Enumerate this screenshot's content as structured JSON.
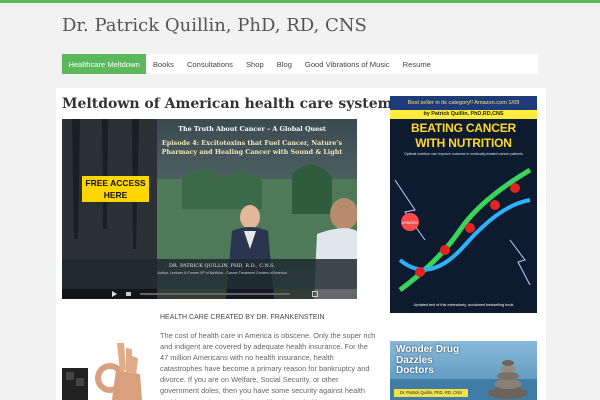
{
  "site": {
    "title": "Dr. Patrick Quillin, PhD, RD, CNS",
    "accent_color": "#5cb85c"
  },
  "nav": {
    "items": [
      {
        "label": "Healthcare Meltdown",
        "active": true
      },
      {
        "label": "Books"
      },
      {
        "label": "Consultations"
      },
      {
        "label": "Shop"
      },
      {
        "label": "Blog"
      },
      {
        "label": "Good Vibrations of Music"
      },
      {
        "label": "Resume"
      }
    ]
  },
  "post": {
    "title": "Meltdown of American health care system",
    "video": {
      "title": "The Truth About Cancer – A Global Quest",
      "subtitle": "Episode 4: Excitotoxins that Fuel Cancer, Nature’s Pharmacy and Healing Cancer with Sound & Light",
      "badge": "FREE ACCESS HERE",
      "caption": "DR. PATRICK QUILLIN, PHD, R.D., C.N.S.",
      "caption2": "Author, Lecturer & Former VP of Nutrition - Cancer Treatment Centers of America"
    },
    "byline": "HEALTH CARE CREATED BY DR. FRANKENSTEIN",
    "body": "The cost of health care in America is obscene. Only the super rich and indigent are covered by adequate health insurance. For the 47 million Americans with no health insurance, health catastrophes have become a primary reason for bankruptcy and divorce. If you are on Welfare, Social Security, or other government doles, then you have some security against health problems. Border states from California to Florida spend many billions annually treating illegal aliens and"
  },
  "sidebar": {
    "book1": {
      "banner": "Best seller in its category!! Amazon.com 1/09",
      "author": "by Patrick Quillin, PhD,RD,CNS",
      "title_line1": "BEATING CANCER",
      "title_line2": "WITH NUTRITION",
      "subtitle": "Optimal nutrition can improve outcome in medically-treated cancer patients",
      "footer": "Updated text of this extensively, acclaimed bestselling book"
    },
    "book2": {
      "title": "Wonder Drug Dazzles Doctors",
      "author": "Dr. Patrick Quillin, PhD, RD, CNS"
    }
  }
}
